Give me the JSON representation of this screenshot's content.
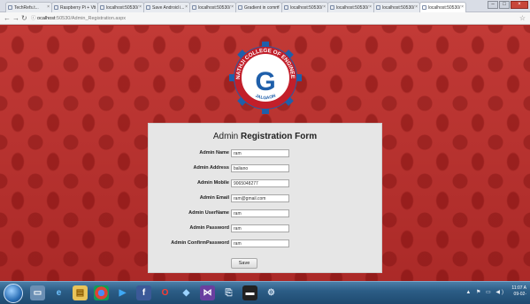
{
  "browser": {
    "tabs": [
      {
        "label": "TechRefs.t..."
      },
      {
        "label": "Raspberry Pi + Vs"
      },
      {
        "label": "localhost:50530/"
      },
      {
        "label": "Save Android i..."
      },
      {
        "label": "localhost:50530/"
      },
      {
        "label": "Gradient in comm"
      },
      {
        "label": "localhost:50530/"
      },
      {
        "label": "localhost:50530/"
      },
      {
        "label": "localhost:50530/"
      },
      {
        "label": "localhost:50530/"
      }
    ],
    "address": {
      "prefix": "ocalhost",
      "path": ":50530/Admin_Registration.aspx"
    }
  },
  "logo": {
    "text_top": "SHRINATHJI COLLEGE OF ENGINEERING",
    "letter": "G",
    "text_bottom": "JALGAON"
  },
  "form": {
    "title_light": "Admin",
    "title_bold": "Registration Form",
    "fields": [
      {
        "label": "Admin Name",
        "value": "ram"
      },
      {
        "label": "Admin Address",
        "value": "baliano"
      },
      {
        "label": "Admin Mobile",
        "value": "9065048277"
      },
      {
        "label": "Admin Email",
        "value": "ram@gmail.com"
      },
      {
        "label": "Admin UserName",
        "value": "ram"
      },
      {
        "label": "Admin Password",
        "value": "ram"
      },
      {
        "label": "Admin ConfirmPassword",
        "value": "ram"
      }
    ],
    "save_label": "Save"
  },
  "taskbar": {
    "time": "11:07 A",
    "date": "09-02-"
  }
}
